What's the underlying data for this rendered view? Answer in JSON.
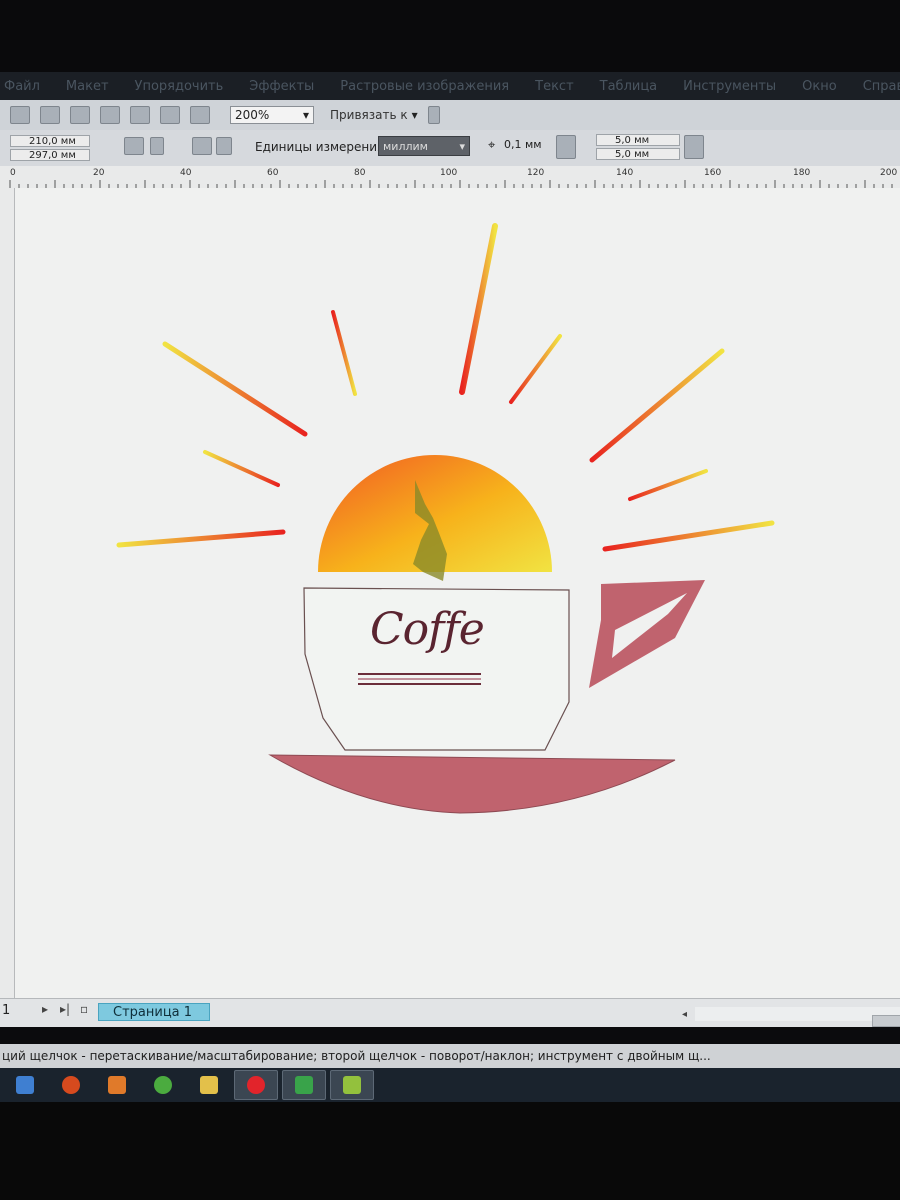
{
  "menu": [
    "Файл",
    "Макет",
    "Упорядочить",
    "Эффекты",
    "Растровые изображения",
    "Текст",
    "Таблица",
    "Инструменты",
    "Окно",
    "Справка"
  ],
  "toolbar": {
    "zoom_value": "200%",
    "snap_label": "Привязать к"
  },
  "property_bar": {
    "width_value": "210,0 мм",
    "height_value": "297,0 мм",
    "units_label": "Единицы измерения:",
    "units_value": "миллим",
    "nudge_value": "0,1 мм",
    "duplicate_x": "5,0 мм",
    "duplicate_y": "5,0 мм"
  },
  "ruler": {
    "ticks": [
      "0",
      "20",
      "40",
      "60",
      "80",
      "100",
      "120",
      "140",
      "160",
      "180",
      "200"
    ]
  },
  "artwork": {
    "cup_text": "Coffe",
    "colors": {
      "ray_start": "#e8231f",
      "ray_end": "#f5e23a",
      "saucer": "#c0636e",
      "handle": "#c0636e",
      "cup_text": "#5a2430"
    }
  },
  "page_nav": {
    "page_number": "1",
    "page_tab": "Страница 1"
  },
  "status": {
    "text": "ций щелчок - перетаскивание/масштабирование; второй щелчок - поворот/наклон; инструмент с двойным щ..."
  },
  "taskbar": {
    "icons": [
      "explorer-icon",
      "painter-icon",
      "media-player-icon",
      "chrome-icon",
      "folder-icon",
      "yandex-icon",
      "coreldraw-icon",
      "app-icon"
    ]
  }
}
